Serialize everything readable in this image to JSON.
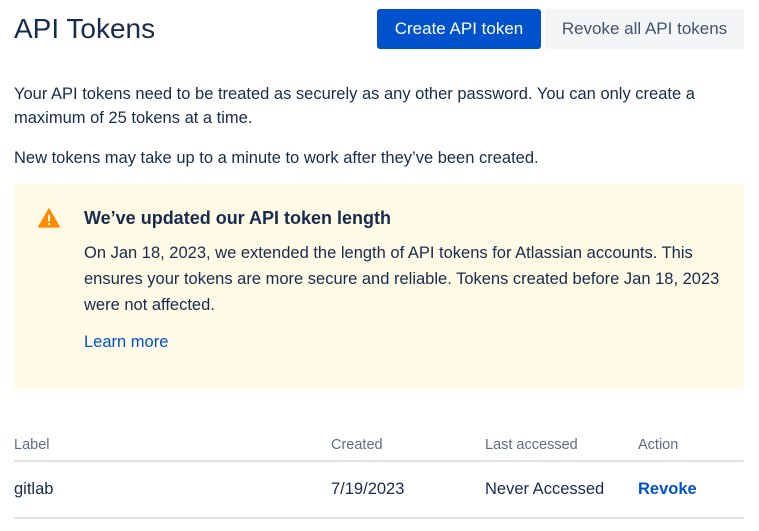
{
  "header": {
    "title": "API Tokens",
    "create_button": "Create API token",
    "revoke_all_button": "Revoke all API tokens"
  },
  "intro": {
    "paragraph1": "Your API tokens need to be treated as securely as any other password. You can only create a maximum of 25 tokens at a time.",
    "paragraph2": "New tokens may take up to a minute to work after they’ve been created."
  },
  "notice": {
    "icon": "warning-icon",
    "icon_color": "#ff8b00",
    "background_color": "#fffae6",
    "title": "We’ve updated our API token length",
    "body": "On Jan 18, 2023, we extended the length of API tokens for Atlassian accounts. This ensures your tokens are more secure and reliable. Tokens created before Jan 18, 2023 were not affected.",
    "link": "Learn more"
  },
  "table": {
    "columns": [
      "Label",
      "Created",
      "Last accessed",
      "Action"
    ],
    "rows": [
      {
        "label": "gitlab",
        "created": "7/19/2023",
        "last_accessed": "Never Accessed",
        "action": "Revoke"
      }
    ]
  },
  "colors": {
    "primary": "#0052cc",
    "text": "#172b4d",
    "subtle_text": "#5e6c84"
  }
}
